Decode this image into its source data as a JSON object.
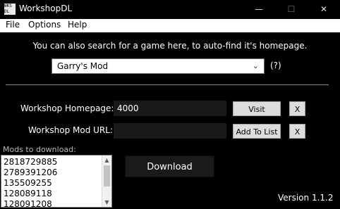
{
  "window": {
    "title": "WorkshopDL",
    "icon_text": "WKS DL",
    "controls": {
      "minimize": "—",
      "maximize": "☐",
      "close": "✕"
    }
  },
  "menu": [
    "File",
    "Options",
    "Help"
  ],
  "prompt": "You can also search for a game here, to auto-find it's homepage.",
  "game_select": {
    "value": "Garry's Mod",
    "chevron": "⌄"
  },
  "help_label": "(?)",
  "homepage": {
    "label": "Workshop Homepage:",
    "value": "4000",
    "visit_label": "Visit",
    "clear_label": "X"
  },
  "mod_url": {
    "label": "Workshop Mod URL:",
    "value": "",
    "add_label": "Add To List",
    "clear_label": "X"
  },
  "mods": {
    "label": "Mods to download:",
    "items": [
      "2818729885",
      "2789391206",
      "135509255",
      "128089118",
      "128091208"
    ]
  },
  "download_label": "Download",
  "version": "Version 1.1.2"
}
